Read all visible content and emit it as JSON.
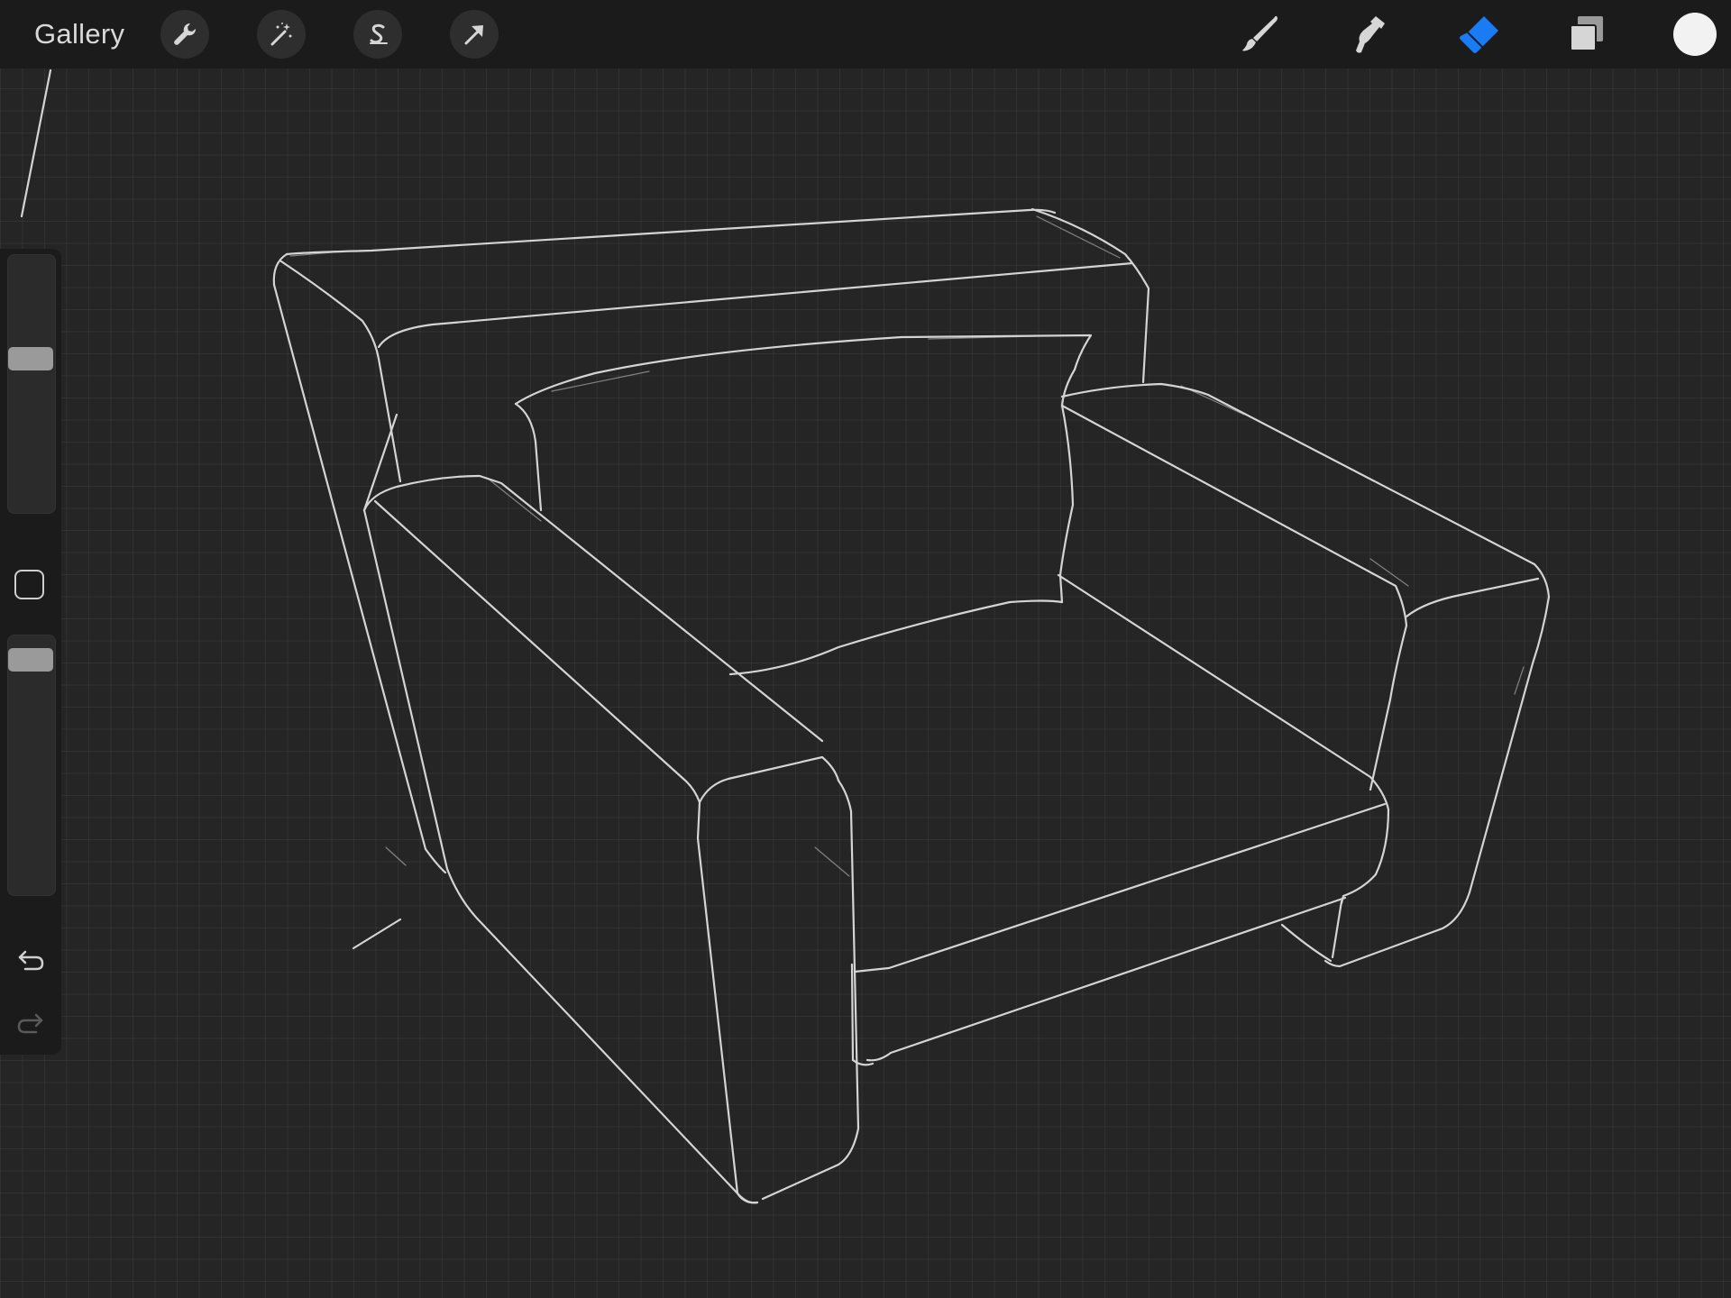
{
  "toolbar": {
    "gallery_label": "Gallery",
    "left_tools": [
      "wrench-icon",
      "magic-wand-icon",
      "selection-icon",
      "transform-arrow-icon"
    ],
    "right_tools": [
      "brush-icon",
      "smudge-icon",
      "eraser-icon",
      "layers-icon"
    ],
    "active_tool": "eraser",
    "active_color": "#1a7cf5",
    "current_color": "#f2f2f2"
  },
  "sidebar": {
    "brush_size_level": 0.36,
    "opacity_level": 0.95,
    "modify_button": "square-icon",
    "undo": "undo-icon",
    "redo": "redo-icon"
  },
  "canvas": {
    "background": "#252525",
    "grid": true,
    "stroke_color": "#e6e6e6",
    "subject": "armchair-sketch"
  }
}
